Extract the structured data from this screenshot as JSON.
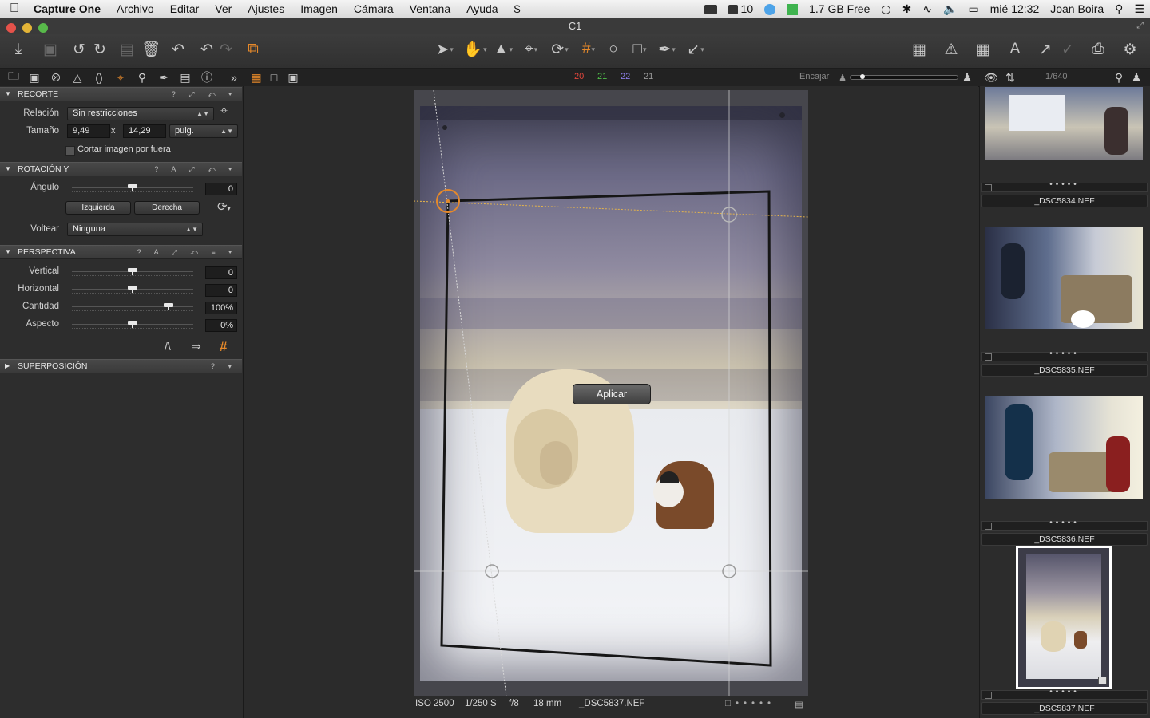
{
  "menubar": {
    "app": "Capture One",
    "items": [
      "Archivo",
      "Editar",
      "Ver",
      "Ajustes",
      "Imagen",
      "Cámara",
      "Ventana",
      "Ayuda"
    ],
    "status": {
      "count": "10",
      "memory": "1.7 GB Free",
      "clock": "mié 12:32",
      "user": "Joan Boira"
    }
  },
  "window": {
    "title": "C1"
  },
  "subbar": {
    "counts": [
      "20",
      "21",
      "22",
      "21"
    ],
    "count_colors": [
      "#e0463c",
      "#4fbf4a",
      "#8b7ee6",
      "#9a9a9a"
    ],
    "fit_label": "Encajar",
    "browser_count": "1/640"
  },
  "crop": {
    "title": "RECORTE",
    "relation_label": "Relación",
    "relation_value": "Sin restricciones",
    "size_label": "Tamaño",
    "width": "9,49",
    "x": "x",
    "height": "14,29",
    "unit": "pulg.",
    "outside_label": "Cortar imagen por fuera"
  },
  "rotation": {
    "title": "ROTACIÓN Y",
    "angle_label": "Ángulo",
    "angle_value": "0",
    "left_btn": "Izquierda",
    "right_btn": "Derecha",
    "flip_label": "Voltear",
    "flip_value": "Ninguna"
  },
  "perspective": {
    "title": "PERSPECTIVA",
    "rows": [
      {
        "label": "Vertical",
        "value": "0",
        "level": 0.5
      },
      {
        "label": "Horizontal",
        "value": "0",
        "level": 0.5
      },
      {
        "label": "Cantidad",
        "value": "100%",
        "level": 0.82
      },
      {
        "label": "Aspecto",
        "value": "0%",
        "level": 0.5
      }
    ]
  },
  "overlay": {
    "title": "SUPERPOSICIÓN"
  },
  "viewer": {
    "apply": "Aplicar",
    "info": {
      "iso": "ISO 2500",
      "shutter": "1/250 S",
      "aperture": "f/8",
      "focal": "18 mm",
      "file": "_DSC5837.NEF"
    }
  },
  "browser": {
    "thumbs": [
      "_DSC5834.NEF",
      "_DSC5835.NEF",
      "_DSC5836.NEF",
      "_DSC5837.NEF"
    ]
  }
}
